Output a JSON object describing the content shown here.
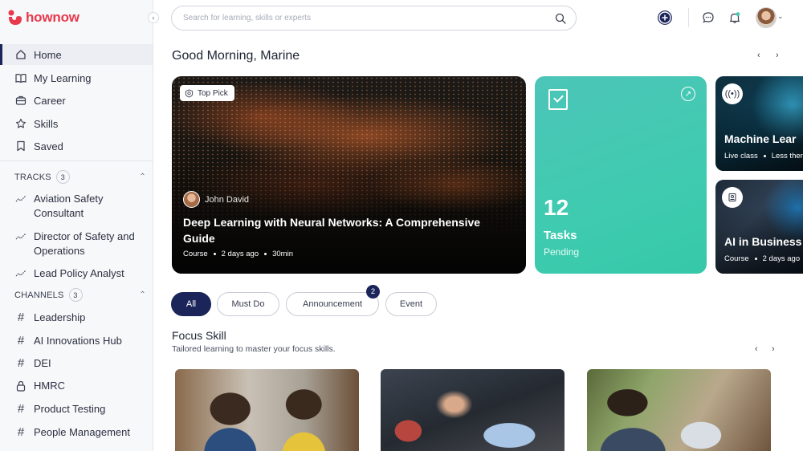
{
  "brand": {
    "name": "hownow",
    "color": "#e8394d",
    "accent": "#1b2559"
  },
  "nav": {
    "items": [
      {
        "label": "Home",
        "icon": "home-icon",
        "active": true
      },
      {
        "label": "My Learning",
        "icon": "book-icon"
      },
      {
        "label": "Career",
        "icon": "briefcase-icon"
      },
      {
        "label": "Skills",
        "icon": "star-icon"
      },
      {
        "label": "Saved",
        "icon": "bookmark-icon"
      }
    ]
  },
  "tracks": {
    "title": "TRACKS",
    "count": "3",
    "items": [
      {
        "label": "Aviation Safety Consultant"
      },
      {
        "label": "Director of Safety and Operations"
      },
      {
        "label": "Lead Policy Analyst"
      }
    ]
  },
  "channels": {
    "title": "CHANNELS",
    "count": "3",
    "items": [
      {
        "label": "Leadership",
        "icon": "hash-icon"
      },
      {
        "label": "AI Innovations Hub",
        "icon": "hash-icon"
      },
      {
        "label": "DEI",
        "icon": "hash-icon"
      },
      {
        "label": "HMRC",
        "icon": "lock-icon"
      },
      {
        "label": "Product Testing",
        "icon": "hash-icon"
      },
      {
        "label": "People Management",
        "icon": "hash-icon"
      }
    ]
  },
  "search": {
    "placeholder": "Search for learning, skills or experts"
  },
  "greeting": "Good Morning, Marine",
  "hero": {
    "badge": "Top Pick",
    "author": "John David",
    "title": "Deep Learning with Neural Networks: A Comprehensive Guide",
    "type": "Course",
    "posted": "2 days ago",
    "duration": "30min"
  },
  "tasks": {
    "count": "12",
    "label": "Tasks",
    "status": "Pending"
  },
  "side_cards": [
    {
      "title": "Machine Lear",
      "meta1": "Live class",
      "meta2": "Less ther"
    },
    {
      "title": "AI in Business",
      "meta1": "Course",
      "meta2": "2 days ago"
    }
  ],
  "filters": {
    "items": [
      "All",
      "Must Do",
      "Announcement",
      "Event"
    ],
    "announcement_count": "2"
  },
  "focus": {
    "title": "Focus Skill",
    "subtitle": "Tailored learning to master your focus skills."
  }
}
